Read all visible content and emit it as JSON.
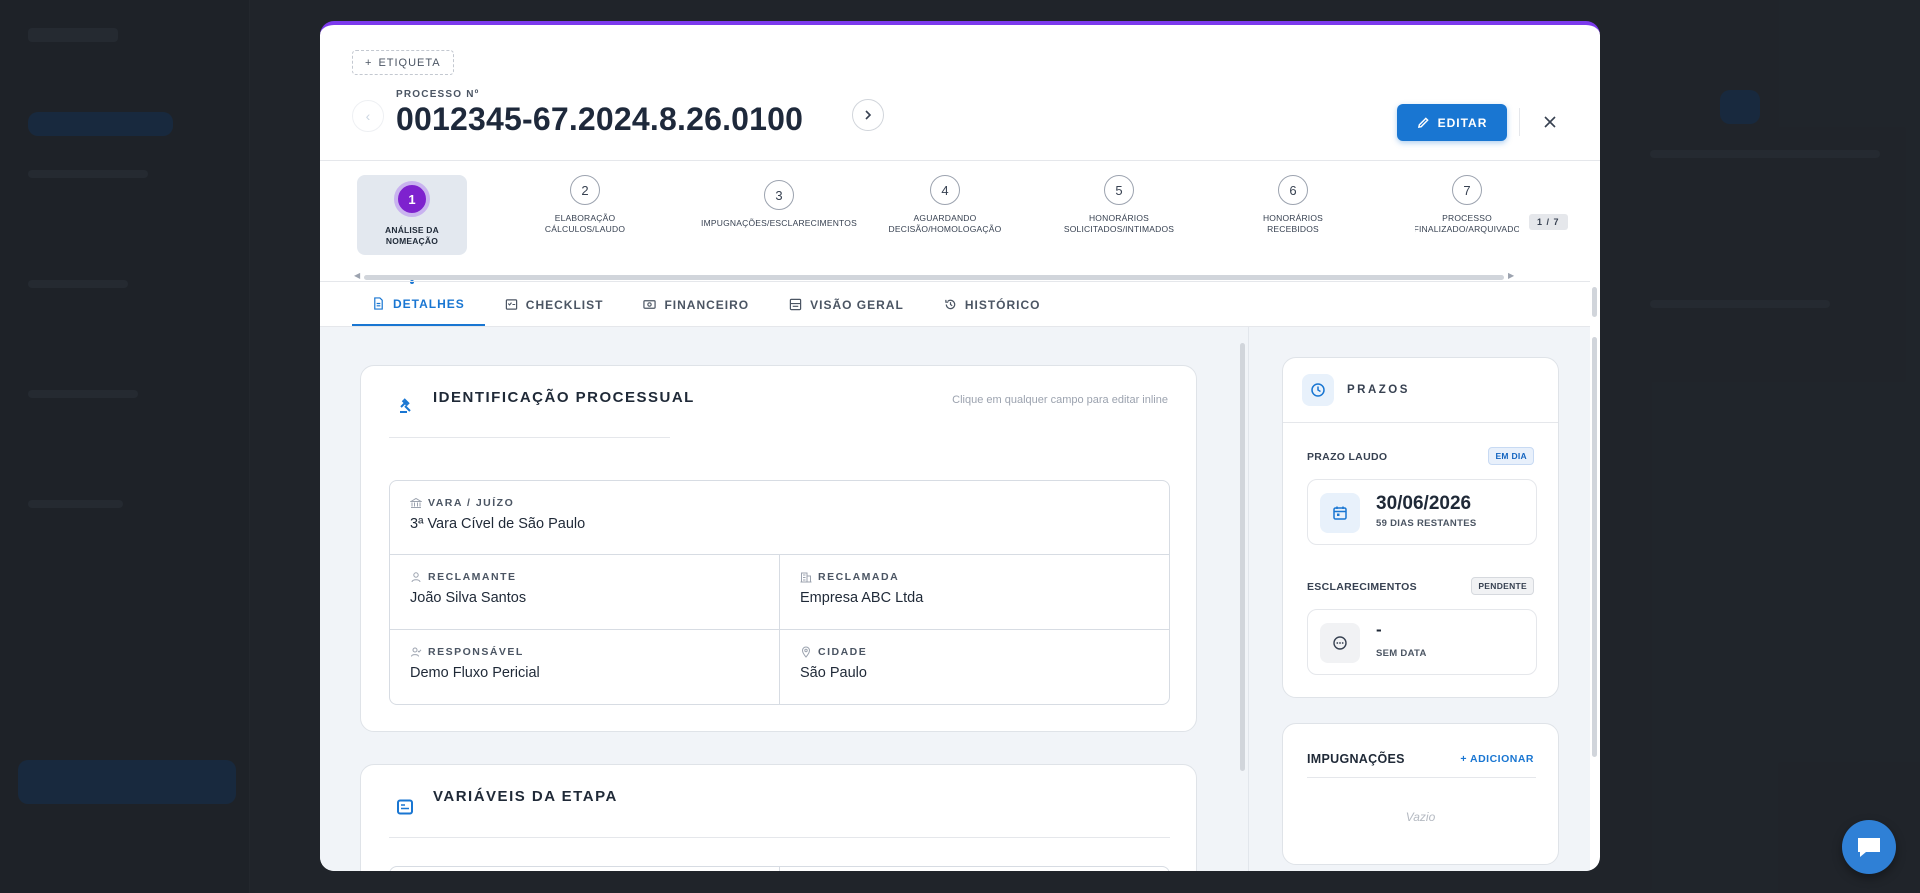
{
  "modal": {
    "tag_button": "ETIQUETA",
    "process_label": "PROCESSO Nº",
    "process_number": "0012345-67.2024.8.26.0100",
    "edit_button": "EDITAR"
  },
  "stepper": {
    "counter": "1 / 7",
    "steps": [
      {
        "number": "1",
        "label_l1": "ANÁLISE DA",
        "label_l2": "NOMEAÇÃO"
      },
      {
        "number": "2",
        "label_l1": "ELABORAÇÃO",
        "label_l2": "CÁLCULOS/LAUDO"
      },
      {
        "number": "3",
        "label_l1": "IMPUGNAÇÕES/ESCLARECIMENTOS",
        "label_l2": ""
      },
      {
        "number": "4",
        "label_l1": "AGUARDANDO",
        "label_l2": "DECISÃO/HOMOLOGAÇÃO"
      },
      {
        "number": "5",
        "label_l1": "HONORÁRIOS",
        "label_l2": "SOLICITADOS/INTIMADOS"
      },
      {
        "number": "6",
        "label_l1": "HONORÁRIOS",
        "label_l2": "RECEBIDOS"
      },
      {
        "number": "7",
        "label_l1": "PROCESSO",
        "label_l2": "FINALIZADO/ARQUIVADO"
      }
    ]
  },
  "tabs": [
    {
      "label": "DETALHES",
      "icon": "document-icon"
    },
    {
      "label": "CHECKLIST",
      "icon": "checklist-icon"
    },
    {
      "label": "FINANCEIRO",
      "icon": "money-icon"
    },
    {
      "label": "VISÃO GERAL",
      "icon": "overview-icon"
    },
    {
      "label": "HISTÓRICO",
      "icon": "history-icon"
    }
  ],
  "identification": {
    "title": "IDENTIFICAÇÃO PROCESSUAL",
    "hint": "Clique em qualquer campo para editar inline",
    "fields": {
      "vara": {
        "label": "VARA / JUÍZO",
        "value": "3ª Vara Cível de São Paulo"
      },
      "reclamante": {
        "label": "RECLAMANTE",
        "value": "João Silva Santos"
      },
      "reclamada": {
        "label": "RECLAMADA",
        "value": "Empresa ABC Ltda"
      },
      "responsavel": {
        "label": "RESPONSÁVEL",
        "value": "Demo Fluxo Pericial"
      },
      "cidade": {
        "label": "CIDADE",
        "value": "São Paulo"
      }
    }
  },
  "variables": {
    "title": "VARIÁVEIS DA ETAPA"
  },
  "prazos": {
    "title": "PRAZOS",
    "laudo": {
      "label": "PRAZO LAUDO",
      "badge": "EM DIA",
      "date": "30/06/2026",
      "remaining": "59 DIAS RESTANTES"
    },
    "esclarecimentos": {
      "label": "ESCLARECIMENTOS",
      "badge": "PENDENTE",
      "date": "-",
      "remaining": "SEM DATA"
    }
  },
  "impugnacoes": {
    "title": "IMPUGNAÇÕES",
    "add": "ADICIONAR",
    "empty": "Vazio"
  },
  "colors": {
    "accent": "#1976d2",
    "active_step": "#7e22ce",
    "modal_top_border": "#7c3aed"
  }
}
